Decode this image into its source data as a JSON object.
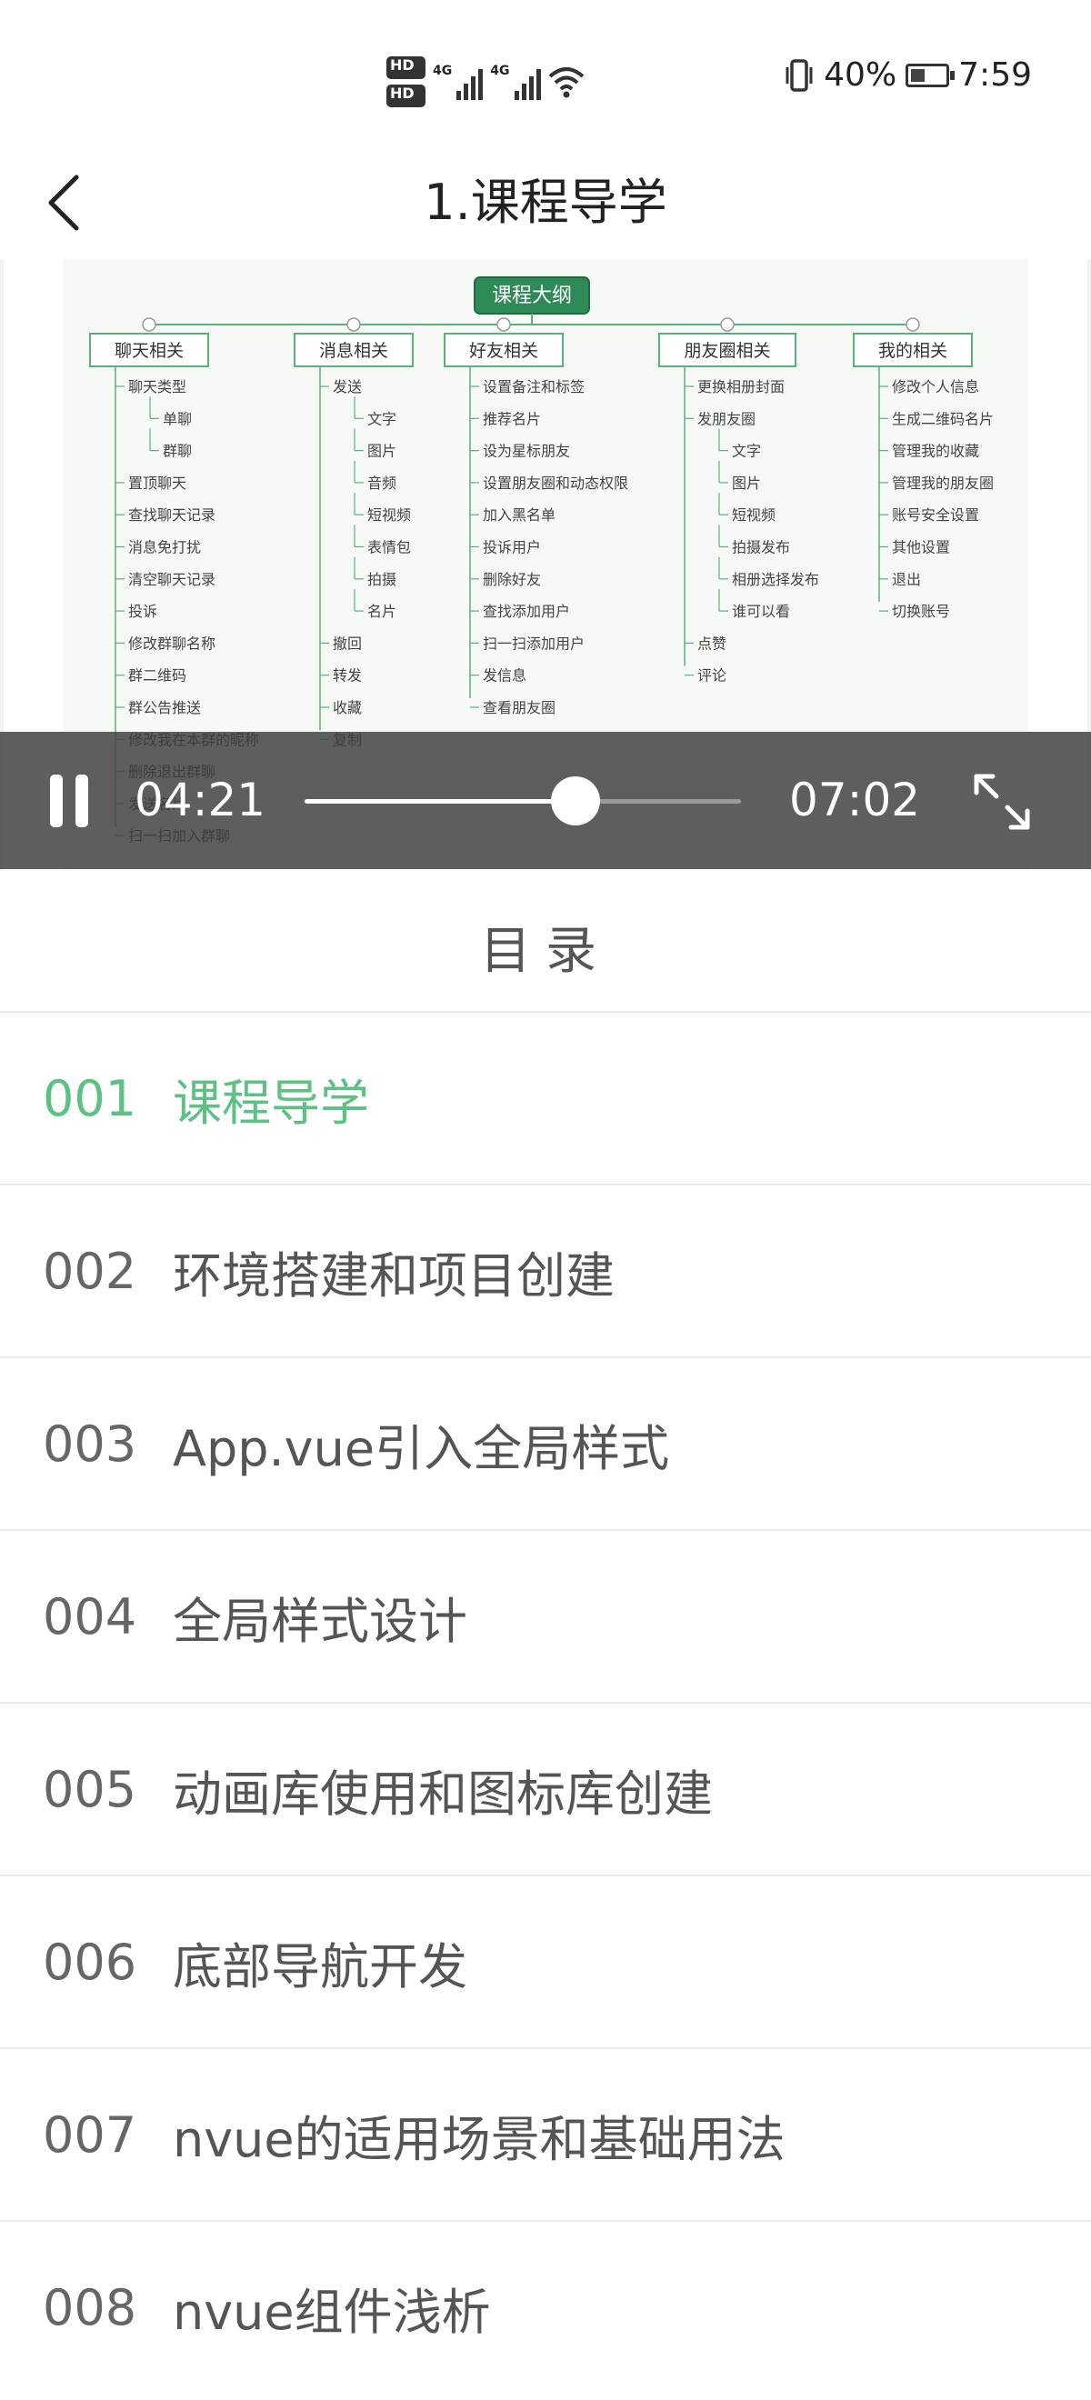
{
  "status_bar": {
    "hd1": "HD",
    "hd1_sub": "1",
    "hd2": "HD",
    "hd2_sub": "2",
    "net1": "4G",
    "net2": "4G",
    "battery_percent": "40%",
    "time": "7:59",
    "battery_level": 0.4
  },
  "nav": {
    "back_icon": "chevron-left-icon",
    "title": "1.课程导学"
  },
  "video": {
    "current_time": "04:21",
    "duration": "07:02",
    "progress": 0.62,
    "slide": {
      "root": "课程大纲",
      "columns": [
        {
          "header": "聊天相关",
          "items": [
            "聊天类型",
            "单聊",
            "群聊",
            "置顶聊天",
            "查找聊天记录",
            "消息免打扰",
            "清空聊天记录",
            "投诉",
            "修改群聊名称",
            "群二维码",
            "群公告推送",
            "修改我在本群的昵称",
            "删除退出群聊",
            "发送名片",
            "扫一扫加入群聊"
          ]
        },
        {
          "header": "消息相关",
          "items": [
            "发送",
            "文字",
            "图片",
            "音频",
            "短视频",
            "表情包",
            "拍摄",
            "名片",
            "撤回",
            "转发",
            "收藏",
            "复制"
          ]
        },
        {
          "header": "好友相关",
          "items": [
            "设置备注和标签",
            "推荐名片",
            "设为星标朋友",
            "设置朋友圈和动态权限",
            "加入黑名单",
            "投诉用户",
            "删除好友",
            "查找添加用户",
            "扫一扫添加用户",
            "发信息",
            "查看朋友圈"
          ]
        },
        {
          "header": "朋友圈相关",
          "items": [
            "更换相册封面",
            "发朋友圈",
            "文字",
            "图片",
            "短视频",
            "拍摄发布",
            "相册选择发布",
            "谁可以看",
            "点赞",
            "评论"
          ]
        },
        {
          "header": "我的相关",
          "items": [
            "修改个人信息",
            "生成二维码名片",
            "管理我的收藏",
            "管理我的朋友圈",
            "账号安全设置",
            "其他设置",
            "退出",
            "切换账号"
          ]
        }
      ]
    }
  },
  "catalog": {
    "title": "目录",
    "items": [
      {
        "num": "001",
        "name": "课程导学",
        "active": true
      },
      {
        "num": "002",
        "name": "环境搭建和项目创建"
      },
      {
        "num": "003",
        "name": "App.vue引入全局样式"
      },
      {
        "num": "004",
        "name": "全局样式设计"
      },
      {
        "num": "005",
        "name": "动画库使用和图标库创建"
      },
      {
        "num": "006",
        "name": "底部导航开发"
      },
      {
        "num": "007",
        "name": "nvue的适用场景和基础用法"
      },
      {
        "num": "008",
        "name": "nvue组件浅析"
      }
    ]
  },
  "colors": {
    "accent": "#5dc184",
    "slide_header_border": "#5db07c",
    "slide_root_bg": "#2e8b57"
  }
}
